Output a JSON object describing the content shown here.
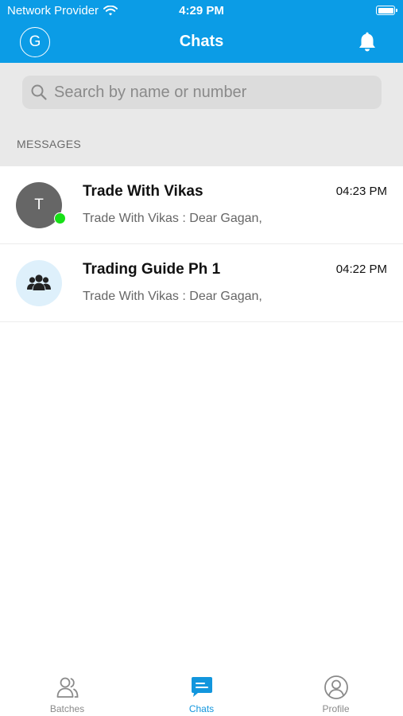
{
  "status_bar": {
    "carrier": "Network Provider",
    "time": "4:29 PM"
  },
  "nav": {
    "avatar_letter": "G",
    "title": "Chats"
  },
  "search": {
    "placeholder": "Search by name or number",
    "value": ""
  },
  "section_label": "MESSAGES",
  "chats": [
    {
      "avatar": "T",
      "name": "Trade With Vikas",
      "time": "04:23 PM",
      "preview": "Trade With Vikas : Dear Gagan,",
      "online": true
    },
    {
      "avatar_icon": "group-icon",
      "name": "Trading Guide Ph 1",
      "time": "04:22 PM",
      "preview": "Trade With Vikas : Dear Gagan,",
      "online": false
    }
  ],
  "tabs": [
    {
      "label": "Batches",
      "icon": "batches-icon",
      "active": false
    },
    {
      "label": "Chats",
      "icon": "chats-icon",
      "active": true
    },
    {
      "label": "Profile",
      "icon": "profile-icon",
      "active": false
    }
  ],
  "colors": {
    "brand_blue": "#0b9ce6",
    "online_green": "#17e017",
    "active_tab": "#1296dd",
    "inactive_tab": "#8a8a8a"
  }
}
